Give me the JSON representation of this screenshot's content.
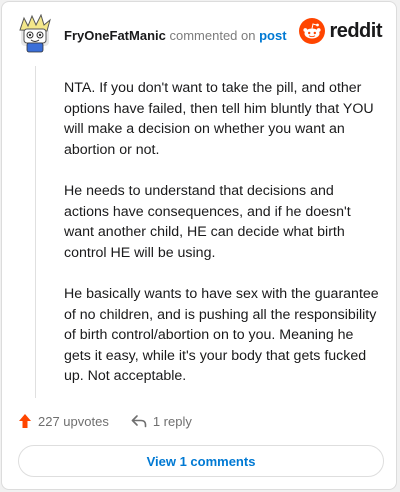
{
  "header": {
    "username": "FryOneFatManic",
    "action_text": "commented on",
    "post_link": "post",
    "brand": "reddit"
  },
  "comment": {
    "paragraphs": [
      "NTA. If you don't want to take the pill, and other options have failed, then tell him bluntly that YOU will make a decision on whether you want an abortion or not.",
      "He needs to understand that decisions and actions have consequences, and if he doesn't want another child, HE can decide what birth control HE will be using.",
      "He basically wants to have sex with the guarantee of no children, and is pushing all the responsibility of birth control/abortion on to you. Meaning he gets it easy, while it's your body that gets fucked up. Not acceptable."
    ]
  },
  "actions": {
    "upvotes": "227 upvotes",
    "replies": "1 reply"
  },
  "view_button": "View 1 comments",
  "colors": {
    "brand_orange": "#ff4500",
    "link_blue": "#0079d3",
    "upvote": "#ff4500"
  }
}
